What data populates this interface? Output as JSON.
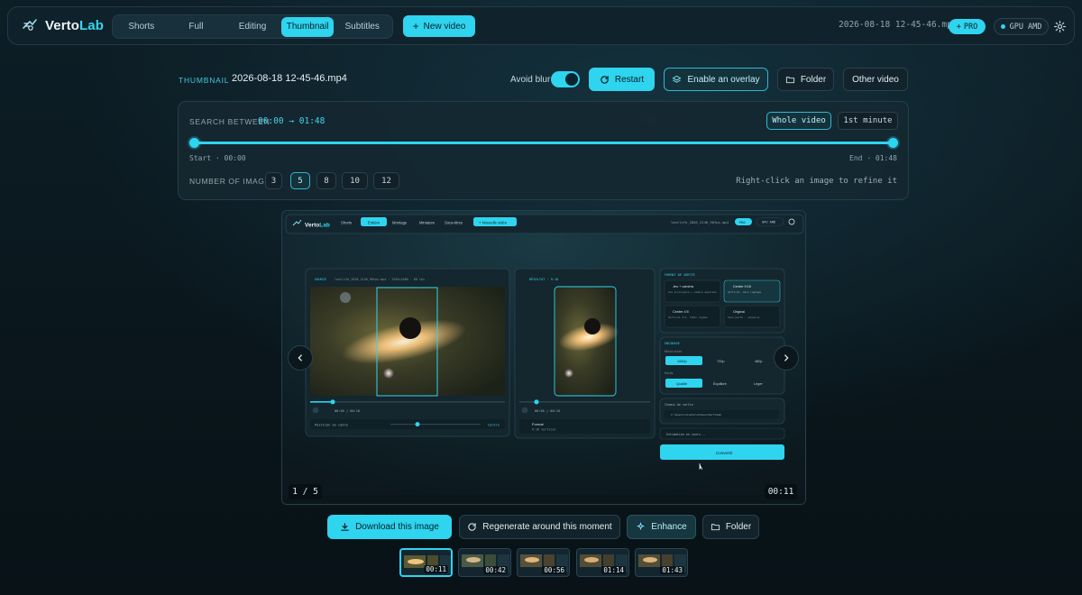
{
  "app": {
    "logo_plain": "Verto",
    "logo_accent": "Lab",
    "tabs": [
      "Shorts",
      "Full",
      "Editing",
      "Thumbnail",
      "Subtitles"
    ],
    "active_tab": "Thumbnail",
    "new_video_label": "New video",
    "current_file": "2026-08-18 12-45-46.mp4",
    "pro_badge": "PRO",
    "gpu_badge": "GPU AMD"
  },
  "header": {
    "section_label": "THUMBNAIL",
    "filename": "2026-08-18 12-45-46.mp4",
    "avoid_blur_label": "Avoid blur",
    "avoid_blur_on": true,
    "restart_label": "Restart",
    "overlay_label": "Enable an overlay",
    "folder_label": "Folder",
    "other_video_label": "Other video"
  },
  "search": {
    "label": "SEARCH BETWEEN",
    "range": "00:00 → 01:48",
    "whole_video_label": "Whole video",
    "first_minute_label": "1st minute",
    "start_caption": "Start · 00:00",
    "end_caption": "End · 01:48",
    "number_label": "NUMBER OF IMAGES",
    "counts": [
      "3",
      "5",
      "8",
      "10",
      "12"
    ],
    "selected_count": "5",
    "refine_hint": "Right-click an image to refine it"
  },
  "preview": {
    "counter": "1 / 5",
    "timecode": "00:11",
    "inner": {
      "logo_plain": "Verto",
      "logo_accent": "Lab",
      "tabs": [
        "Shorts",
        "Entière",
        "Montage",
        "Miniature",
        "Sous-titres"
      ],
      "new_video": "+ Nouvelle vidéo",
      "file": "lastlife_2026_2146_90fps.mp4",
      "pro": "PRO",
      "gpu": "GPU AMD",
      "source_label": "SOURCE",
      "source_file": "lastlife_2026_2146_90fps.mp4 · 1920×1080 · 60 fps",
      "result_label": "RÉSULTAT · 9:16",
      "source_time": "00:05 / 00:16",
      "result_time": "00:05 / 00:16",
      "frame_position": "Position du cadre",
      "frame_center": "Centre",
      "format_label": "Format",
      "format_value": "9:16 vertical",
      "output_format_title": "FORMAT DE SORTIE",
      "opt1": "Jeu + caméra",
      "opt1_sub": "Vue principale + caméra empilées",
      "opt2": "Centre 9:16",
      "opt2_sub": "Vertical, zéro rognage",
      "opt3": "Centre 4:5",
      "opt3_sub": "Vertical 4:5, idéal rognés",
      "opt4": "Original",
      "opt4_sub": "Sans perte · conserve",
      "encoding_title": "ENCODAGE",
      "resolution_label": "Résolution",
      "resolutions": [
        "1080p",
        "720p",
        "480p"
      ],
      "weight_label": "Poids",
      "weights": [
        "Qualité",
        "Équilibré",
        "Léger"
      ],
      "output_path_label": "Chemin de sortie",
      "output_path": "C:\\Users\\studio\\Videos\\VertoLab",
      "estimation": "Estimation en cours...",
      "convert": "Convertir"
    }
  },
  "actions": {
    "download_label": "Download this image",
    "regenerate_label": "Regenerate around this moment",
    "enhance_label": "Enhance",
    "folder_label": "Folder"
  },
  "thumbnails": [
    {
      "time": "00:11",
      "active": true
    },
    {
      "time": "00:42",
      "active": false
    },
    {
      "time": "00:56",
      "active": false
    },
    {
      "time": "01:14",
      "active": false
    },
    {
      "time": "01:43",
      "active": false
    }
  ],
  "colors": {
    "accent": "#2fd4ef",
    "background": "#0b171c",
    "panel": "#152831"
  },
  "icons": [
    "logo-icon",
    "plus-icon",
    "gear-icon",
    "restart-icon",
    "layers-icon",
    "folder-icon",
    "chevron-left-icon",
    "chevron-right-icon",
    "download-icon",
    "refresh-icon",
    "sparkle-icon"
  ]
}
